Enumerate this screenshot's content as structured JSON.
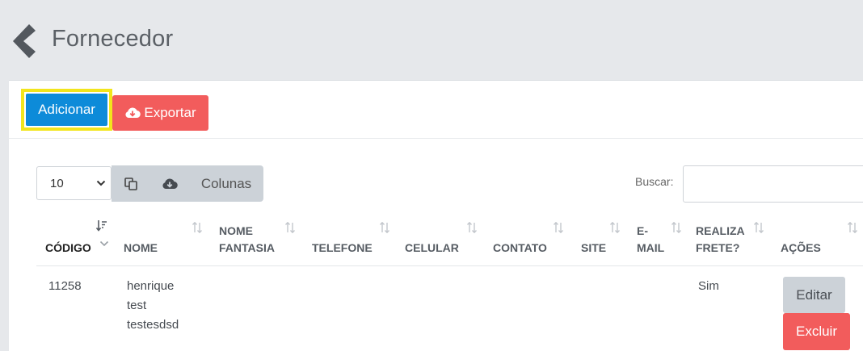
{
  "page": {
    "title": "Fornecedor"
  },
  "toolbar": {
    "add_label": "Adicionar",
    "export_label": "Exportar"
  },
  "table_controls": {
    "length_value": "10",
    "columns_label": "Colunas",
    "search_label": "Buscar:",
    "search_value": ""
  },
  "table": {
    "columns": [
      {
        "key": "codigo",
        "line1": "",
        "line2": "CÓDIGO"
      },
      {
        "key": "nome",
        "line1": "",
        "line2": "NOME"
      },
      {
        "key": "nome_fantasia",
        "line1": "NOME",
        "line2": "FANTASIA"
      },
      {
        "key": "telefone",
        "line1": "",
        "line2": "TELEFONE"
      },
      {
        "key": "celular",
        "line1": "",
        "line2": "CELULAR"
      },
      {
        "key": "contato",
        "line1": "",
        "line2": "CONTATO"
      },
      {
        "key": "site",
        "line1": "",
        "line2": "SITE"
      },
      {
        "key": "email",
        "line1": "E-",
        "line2": "MAIL"
      },
      {
        "key": "realiza_frete",
        "line1": "REALIZA",
        "line2": "FRETE?"
      },
      {
        "key": "acoes",
        "line1": "",
        "line2": "AÇÕES"
      }
    ],
    "rows": [
      {
        "codigo": "11258",
        "nome": [
          "henrique",
          "test",
          "testesdsd"
        ],
        "realiza_frete": "Sim",
        "edit_label": "Editar",
        "delete_label": "Excluir"
      }
    ]
  },
  "icons": {
    "back": "chevron-left-icon",
    "export": "cloud-download-icon",
    "copy": "copy-icon",
    "download": "cloud-download-icon",
    "sort": "sort-icon",
    "select": "chevron-down-icon"
  },
  "colors": {
    "primary": "#0d8bd9",
    "danger": "#f25c5c",
    "secondary": "#ccd2d8",
    "highlight": "#f2e51c",
    "background": "#e6e8eb"
  }
}
